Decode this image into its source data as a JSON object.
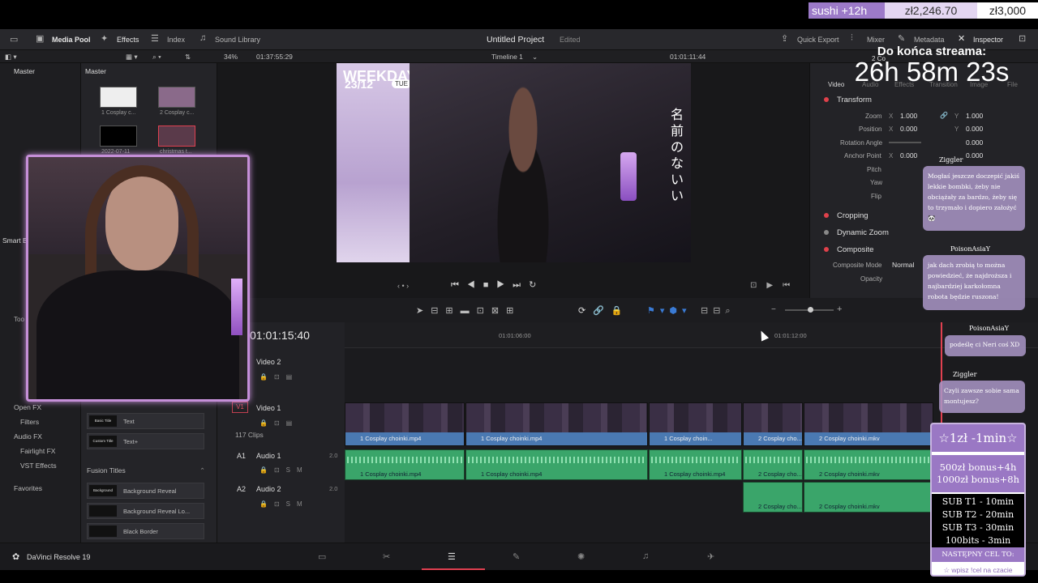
{
  "stream_bar": {
    "sub_time": "sushi +12h",
    "amount": "zł2,246.70",
    "goal": "zł3,000"
  },
  "toolbar": {
    "media_pool": "Media Pool",
    "effects": "Effects",
    "index": "Index",
    "sound_library": "Sound Library",
    "project_title": "Untitled Project",
    "edited": "Edited",
    "quick_export": "Quick Export",
    "mixer": "Mixer",
    "metadata": "Metadata",
    "inspector": "Inspector"
  },
  "subbar": {
    "zoom": "34%",
    "source_tc": "01:37:55:29",
    "timeline_name": "Timeline 1",
    "record_tc": "01:01:11:44"
  },
  "left_panel": {
    "master": "Master",
    "smart": "Smart B",
    "toolbox": "Too",
    "open_fx": "Open FX",
    "filters": "Filters",
    "audio_fx": "Audio FX",
    "fairlight": "Fairlight FX",
    "vst": "VST Effects",
    "favorites": "Favorites"
  },
  "media": {
    "master": "Master",
    "clips": [
      {
        "label": "1 Cosplay c..."
      },
      {
        "label": "2 Cosplay c..."
      },
      {
        "label": "2022-07-11"
      },
      {
        "label": "christmas t..."
      }
    ],
    "titles": [
      {
        "thumb": "Basic Title",
        "label": "Text"
      },
      {
        "thumb": "Custom Title",
        "label": "Text+"
      }
    ],
    "fusion_header": "Fusion Titles",
    "fusion": [
      {
        "thumb": "Background Reveal",
        "label": "Background Reveal"
      },
      {
        "thumb": "",
        "label": "Background Reveal Lo..."
      },
      {
        "thumb": "",
        "label": "Black Border"
      }
    ]
  },
  "preview": {
    "weekday": "WEEKDAY",
    "date": "23/12",
    "day": "TUE",
    "kanji": "名前のないい"
  },
  "inspector": {
    "tabs": [
      "Video",
      "Audio",
      "Effects",
      "Transition",
      "Image",
      "File"
    ],
    "clip_name": "2 Co",
    "transform": "Transform",
    "zoom_label": "Zoom",
    "zoom_x": "1.000",
    "zoom_y": "1.000",
    "position_label": "Position",
    "pos_x": "0.000",
    "pos_y": "0.000",
    "rotation_label": "Rotation Angle",
    "rotation": "0.000",
    "anchor_label": "Anchor Point",
    "anchor_x": "0.000",
    "anchor_y": "0.000",
    "pitch": "Pitch",
    "yaw": "Yaw",
    "flip": "Flip",
    "cropping": "Cropping",
    "dynamic_zoom": "Dynamic Zoom",
    "composite": "Composite",
    "composite_mode_label": "Composite Mode",
    "composite_mode": "Normal",
    "opacity": "Opacity"
  },
  "timer": {
    "title": "Do końca streama:",
    "value": "26h 58m 23s"
  },
  "timeline": {
    "timecode": "01:01:15:40",
    "ruler": [
      "01:01:06:00",
      "01:01:12:00"
    ],
    "tracks": [
      {
        "id": "",
        "name": "Video 2",
        "sub": ""
      },
      {
        "id": "V1",
        "name": "Video 1",
        "sub": "117 Clips"
      },
      {
        "id": "A1",
        "name": "Audio 1",
        "sub": "2.0"
      },
      {
        "id": "A2",
        "name": "Audio 2",
        "sub": "2.0"
      }
    ],
    "v1_clips": [
      "1 Cosplay choinki.mp4",
      "1 Cosplay choinki.mp4",
      "1 Cosplay choin...",
      "2 Cosplay cho...",
      "2 Cosplay choinki.mkv"
    ],
    "a1_clips": [
      "1 Cosplay choinki.mp4",
      "1 Cosplay choinki.mp4",
      "1 Cosplay choinki.mp4",
      "2 Cosplay cho...",
      "2 Cosplay choinki.mkv"
    ],
    "a2_clips": [
      "2 Cosplay cho...",
      "2 Cosplay choinki.mkv"
    ]
  },
  "chat": [
    {
      "user": "Ziggler",
      "text": "Mogłaś jeszcze doczepić jakiś lekkie bombki, żeby nie obciążały za bardzo, żeby się to trzymało i dopiero założyć 🐼"
    },
    {
      "user": "PoisonAsiaY",
      "text": "jak dach zrobią to można powiedzieć, że najdroższa i najbardziej karkołomna robota będzie ruszona!"
    },
    {
      "user": "PoisonAsiaY",
      "text": "podeślę ci Neri coś XD"
    },
    {
      "user": "Ziggler",
      "text": "Czyli zawsze sobie sama montujesz?"
    }
  ],
  "promo": {
    "rate": "☆1zł -1min☆",
    "bonus1": "500zł bonus+4h",
    "bonus2": "1000zł bonus+8h",
    "subs": [
      "SUB T1 - 10min",
      "SUB T2 - 20min",
      "SUB T3 - 30min",
      "100bits - 3min"
    ],
    "next": "NASTĘPNY CEL TO:",
    "cel": "☆ wpisz !cel na czacie"
  },
  "bottom": {
    "app": "DaVinci Resolve 19"
  }
}
